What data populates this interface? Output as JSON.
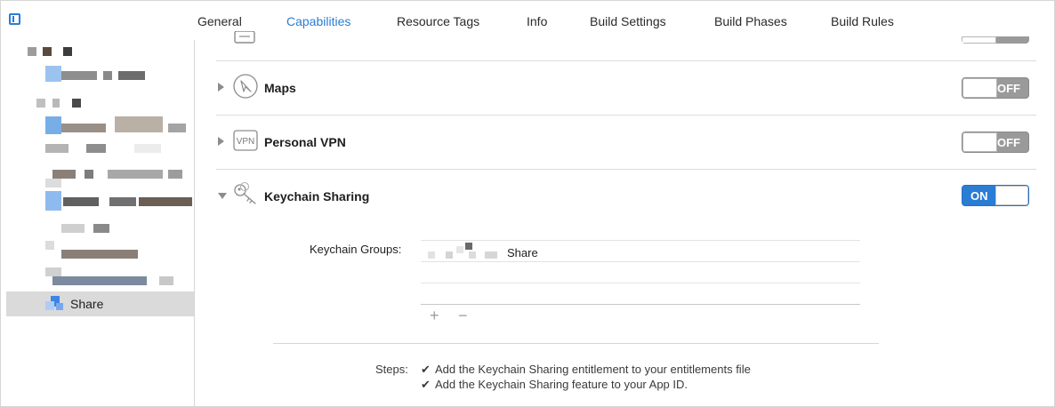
{
  "tabs": [
    {
      "label": "General",
      "active": false
    },
    {
      "label": "Capabilities",
      "active": true
    },
    {
      "label": "Resource Tags",
      "active": false
    },
    {
      "label": "Info",
      "active": false
    },
    {
      "label": "Build Settings",
      "active": false
    },
    {
      "label": "Build Phases",
      "active": false
    },
    {
      "label": "Build Rules",
      "active": false
    }
  ],
  "sidebar": {
    "selected_item": {
      "label": "Share",
      "icon": "app-extension-target-icon"
    }
  },
  "capabilities": [
    {
      "name": "Maps",
      "icon": "maps-compass-icon",
      "expanded": false,
      "switch_label": "OFF"
    },
    {
      "name": "Personal VPN",
      "icon": "vpn-icon",
      "icon_text": "VPN",
      "expanded": false,
      "switch_label": "OFF"
    },
    {
      "name": "Keychain Sharing",
      "icon": "keys-icon",
      "expanded": true,
      "switch_label": "ON"
    }
  ],
  "keychain": {
    "groups_label": "Keychain Groups:",
    "groups": [
      {
        "value": "Share"
      }
    ],
    "add_label": "+",
    "remove_label": "−"
  },
  "steps": {
    "label": "Steps:",
    "items": [
      {
        "check": "✔",
        "text": "Add the Keychain Sharing entitlement to your entitlements file"
      },
      {
        "check": "✔",
        "text": "Add the Keychain Sharing feature to your App ID."
      }
    ]
  },
  "colors": {
    "accent": "#2b7cd4",
    "switch_off": "#9a9a9a",
    "selection": "#dadada"
  }
}
